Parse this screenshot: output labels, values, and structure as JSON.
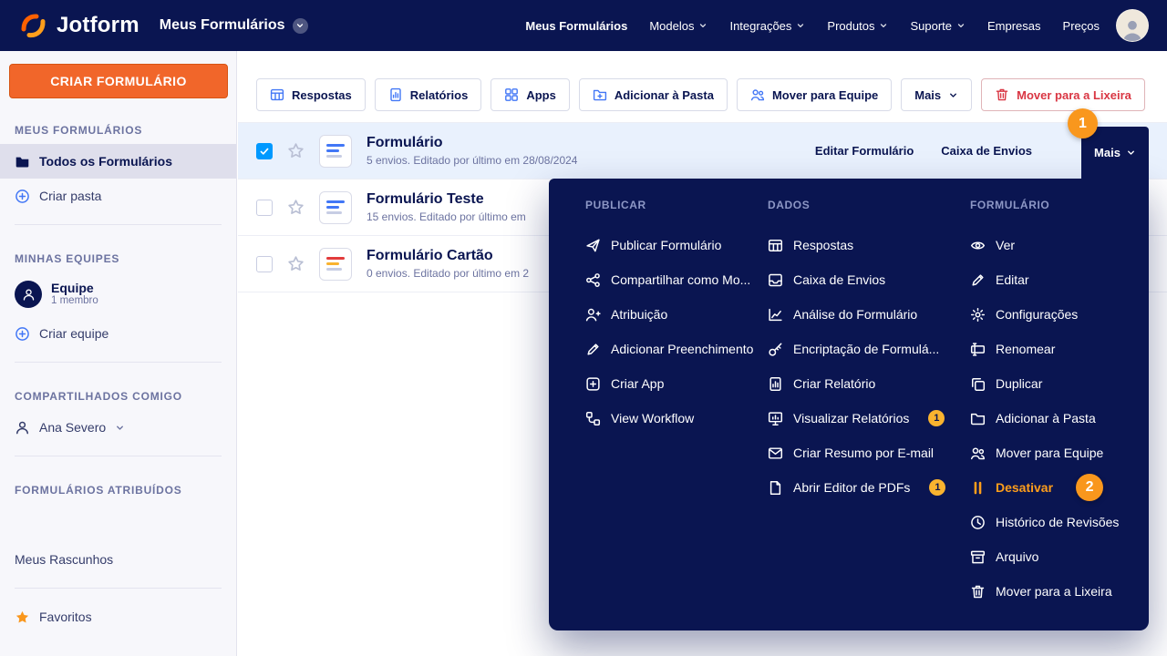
{
  "topnav": {
    "brand": "Jotform",
    "page_title": "Meus Formulários",
    "links": [
      {
        "label": "Meus Formulários"
      },
      {
        "label": "Modelos"
      },
      {
        "label": "Integrações"
      },
      {
        "label": "Produtos"
      },
      {
        "label": "Suporte"
      },
      {
        "label": "Empresas"
      },
      {
        "label": "Preços"
      }
    ]
  },
  "sidebar": {
    "create_form": "CRIAR FORMULÁRIO",
    "sections": {
      "my_forms": "MEUS FORMULÁRIOS",
      "my_teams": "MINHAS EQUIPES",
      "shared": "COMPARTILHADOS COMIGO",
      "assigned": "FORMULÁRIOS ATRIBUÍDOS"
    },
    "all_forms": "Todos os Formulários",
    "create_folder": "Criar pasta",
    "team": {
      "name": "Equipe",
      "members": "1 membro"
    },
    "create_team": "Criar equipe",
    "shared_user": "Ana Severo",
    "drafts": "Meus Rascunhos",
    "favorites": "Favoritos"
  },
  "toolbar": {
    "respostas": "Respostas",
    "relatorios": "Relatórios",
    "apps": "Apps",
    "add_folder": "Adicionar à Pasta",
    "move_team": "Mover para Equipe",
    "mais": "Mais",
    "trash": "Mover para a Lixeira"
  },
  "forms": [
    {
      "title": "Formulário",
      "meta": "5 envios. Editado por último em 28/08/2024"
    },
    {
      "title": "Formulário Teste",
      "meta": "15 envios. Editado por último em"
    },
    {
      "title": "Formulário Cartão",
      "meta": "0 envios. Editado por último em 2"
    }
  ],
  "row_actions": {
    "edit": "Editar Formulário",
    "inbox": "Caixa de Envios",
    "more": "Mais"
  },
  "menu": {
    "columns": [
      {
        "header": "PUBLICAR",
        "items": [
          {
            "label": "Publicar Formulário"
          },
          {
            "label": "Compartilhar como Mo..."
          },
          {
            "label": "Atribuição"
          },
          {
            "label": "Adicionar Preenchimento"
          },
          {
            "label": "Criar App"
          },
          {
            "label": "View Workflow"
          }
        ]
      },
      {
        "header": "DADOS",
        "items": [
          {
            "label": "Respostas"
          },
          {
            "label": "Caixa de Envios"
          },
          {
            "label": "Análise do Formulário"
          },
          {
            "label": "Encriptação de Formulá..."
          },
          {
            "label": "Criar Relatório"
          },
          {
            "label": "Visualizar Relatórios",
            "badge": "1"
          },
          {
            "label": "Criar Resumo por E-mail"
          },
          {
            "label": "Abrir Editor de PDFs",
            "badge": "1"
          }
        ]
      },
      {
        "header": "FORMULÁRIO",
        "items": [
          {
            "label": "Ver"
          },
          {
            "label": "Editar"
          },
          {
            "label": "Configurações"
          },
          {
            "label": "Renomear"
          },
          {
            "label": "Duplicar"
          },
          {
            "label": "Adicionar à Pasta"
          },
          {
            "label": "Mover para Equipe"
          },
          {
            "label": "Desativar"
          },
          {
            "label": "Histórico de Revisões"
          },
          {
            "label": "Arquivo"
          },
          {
            "label": "Mover para a Lixeira"
          }
        ]
      }
    ]
  },
  "annotations": {
    "step1": "1",
    "step2": "2"
  },
  "colors": {
    "navy": "#0a1551",
    "orange": "#f1662a",
    "annotation_orange": "#f9971d",
    "badge_amber": "#f9b32f",
    "link_blue": "#4277f6",
    "danger_red": "#d93643",
    "selected_row": "#e9f1fd",
    "checkbox_blue": "#0099ff"
  }
}
